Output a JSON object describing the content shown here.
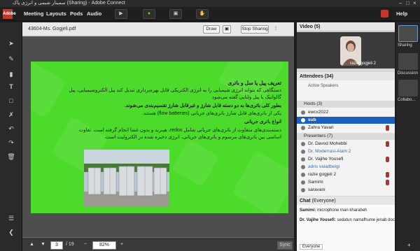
{
  "window": {
    "title": "سمینار شیمی و انرژی پاک (Sharing) - Adobe Connect"
  },
  "logo": {
    "label": "Adobe"
  },
  "menu": [
    "Meeting",
    "Layouts",
    "Pods",
    "Audio"
  ],
  "help_label": "Help",
  "share": {
    "filename": "43604-Ms. Gogjeli.pdf",
    "draw_label": "Draw",
    "stop_label": "Stop Sharing"
  },
  "slide": {
    "lines": [
      {
        "text": "تعریف پیل یا سل و باتری",
        "bold": true
      },
      {
        "text": "دستگاهی که بتواند انرژی شیمیایی را به انرژی الکتریکی قابل بهره‌برداری تبدیل کند پیل الکتروشیمیایی، پیل",
        "bold": false
      },
      {
        "text": "گالوانیک یا پیل ولتایی گفته می‌شود",
        "bold": false
      },
      {
        "text": "بطور کلی باتری‌ها به دو دسته قابل شارژ و غیرقابل شارژ تقسیم‌بندی می‌شوند.",
        "bold": true
      },
      {
        "text": "یکی از باتری‌های قابل شارژ باتری‌های جریانی (flow batteries) هستند.",
        "bold": false
      },
      {
        "text": "انواع باتری جریانی",
        "bold": true
      },
      {
        "text": "دسته‌بندی‌های متفاوت از باتری‌های جریانی شامل redox، هیبرید و بدون غشا انجام گرفته است. تفاوت",
        "bold": false
      },
      {
        "text": "اساسی بین باتری‌های مرسوم و باتری‌های جریانی، انرژی ذخیره شده در الکترولیت است.",
        "bold": false
      }
    ]
  },
  "nav": {
    "page": "3",
    "total": "/ 19",
    "zoom": "82%",
    "sync_label": "Sync"
  },
  "video": {
    "title": "Video",
    "count": "(5)",
    "presenter_label": "razie gogjeli 2"
  },
  "attendees": {
    "title": "Attendees",
    "count": "(34)",
    "active_speakers": "Active Speakers",
    "hosts_label": "Hosts (3)",
    "hosts": [
      "ewcx2022",
      "sub",
      "Zahra Yavari"
    ],
    "presenters_label": "Presenters (7)",
    "presenters": [
      "Dr. Davod Mohebbi",
      "Dr. Moderrasi-Alam 2",
      "Dr. Vajihe Yousefi",
      "adris valadbeigi",
      "razie gogjeli 2",
      "Samimi",
      "saravani"
    ]
  },
  "chat": {
    "title": "Chat",
    "scope": "(Everyone)",
    "messages": [
      {
        "sender": "Samimi:",
        "text": "microphone man kharabeh"
      },
      {
        "sender": "Dr. Vajihe Yousefi:",
        "text": "sedatun namafhume jenab doctor"
      }
    ],
    "tab_label": "Everyone"
  },
  "pods": [
    "Sharing",
    "Discussion",
    "Collabo..."
  ],
  "colors": {
    "slide_bg": "#4cdb2b",
    "accent_red": "#c0392b",
    "selected_row": "#1b5fbf"
  }
}
